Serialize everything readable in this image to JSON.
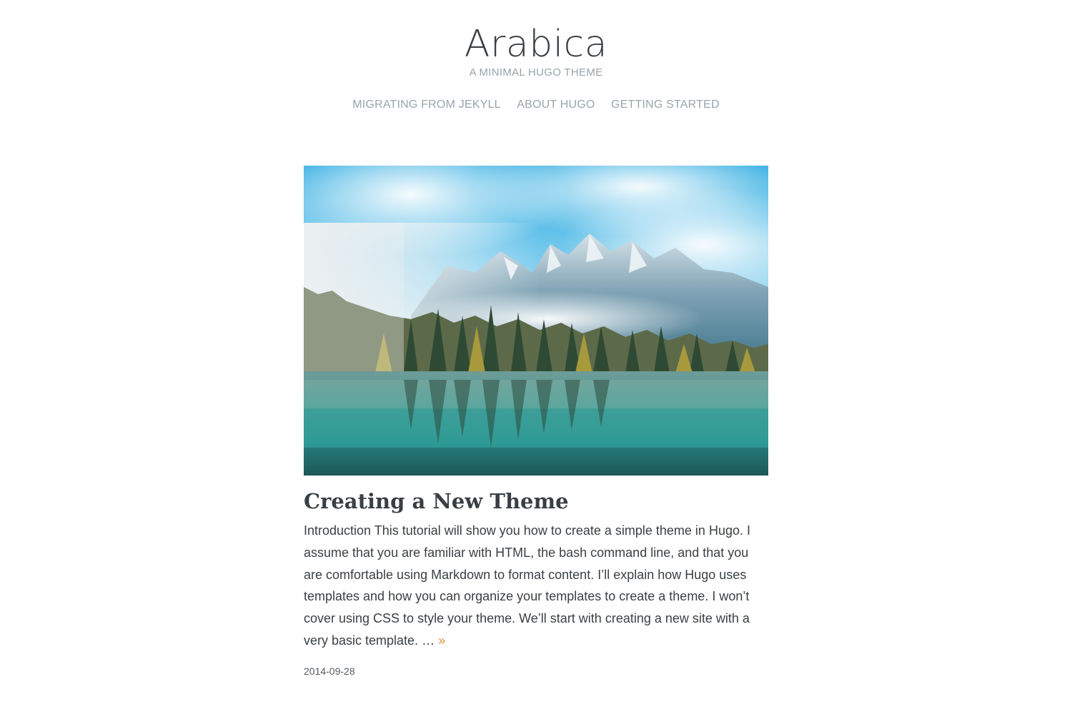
{
  "site": {
    "title": "Arabica",
    "tagline": "A MINIMAL HUGO THEME"
  },
  "nav": {
    "items": [
      {
        "label": "MIGRATING FROM JEKYLL"
      },
      {
        "label": "ABOUT HUGO"
      },
      {
        "label": "GETTING STARTED"
      }
    ]
  },
  "post": {
    "title": "Creating a New Theme",
    "summary": "Introduction This tutorial will show you how to create a simple theme in Hugo. I assume that you are familiar with HTML, the bash command line, and that you are comfortable using Markdown to format content. I’ll explain how Hugo uses templates and how you can organize your templates to create a theme. I won’t cover using CSS to style your theme. We’ll start with creating a new site with a very basic template. …",
    "read_more": "»",
    "date": "2014-09-28"
  },
  "colors": {
    "accent": "#e8892f",
    "muted": "#9aa3ab",
    "text": "#3b3f43"
  }
}
